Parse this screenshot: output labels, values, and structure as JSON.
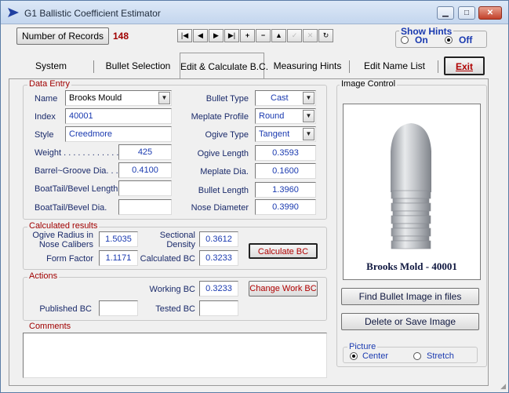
{
  "window": {
    "title": "G1 Ballistic Coefficient Estimator"
  },
  "toolbar": {
    "records_button": "Number of Records",
    "records_count": "148",
    "nav_buttons": [
      "|◀",
      "◀",
      "▶",
      "▶|",
      "+",
      "−",
      "▲",
      "✓",
      "✕",
      "↻"
    ]
  },
  "hints": {
    "label": "Show Hints",
    "on": "On",
    "off": "Off",
    "selected": "Off"
  },
  "tabs": [
    "System",
    "Bullet Selection",
    "Edit & Calculate B.C.",
    "Measuring Hints",
    "Edit Name List"
  ],
  "active_tab": "Edit & Calculate B.C.",
  "exit_button": "Exit",
  "data_entry": {
    "title": "Data Entry",
    "name_label": "Name",
    "name_value": "Brooks Mould",
    "index_label": "Index",
    "index_value": "40001",
    "style_label": "Style",
    "style_value": "Creedmore",
    "weight_label": "Weight . . . . . . . . . . . .",
    "weight_value": "425",
    "barrel_label": "Barrel~Groove Dia. . .",
    "barrel_value": "0.4100",
    "boattail_len_label": "BoatTail/Bevel Length",
    "boattail_len_value": "",
    "boattail_dia_label": "BoatTail/Bevel Dia.",
    "boattail_dia_value": "",
    "bullet_type_label": "Bullet Type",
    "bullet_type_value": "Cast",
    "meplate_profile_label": "Meplate Profile",
    "meplate_profile_value": "Round",
    "ogive_type_label": "Ogive Type",
    "ogive_type_value": "Tangent",
    "ogive_length_label": "Ogive Length",
    "ogive_length_value": "0.3593",
    "meplate_dia_label": "Meplate Dia.",
    "meplate_dia_value": "0.1600",
    "bullet_length_label": "Bullet Length",
    "bullet_length_value": "1.3960",
    "nose_dia_label": "Nose Diameter",
    "nose_dia_value": "0.3990"
  },
  "calculated": {
    "title": "Calculated results",
    "ogive_radius_label_1": "Ogive Radius in",
    "ogive_radius_label_2": "Nose Calibers",
    "ogive_radius_value": "1.5035",
    "sectional_label_1": "Sectional",
    "sectional_label_2": "Density",
    "sectional_value": "0.3612",
    "form_factor_label": "Form Factor",
    "form_factor_value": "1.1171",
    "calc_bc_label": "Calculated BC",
    "calc_bc_value": "0.3233",
    "calculate_button": "Calculate BC"
  },
  "actions": {
    "title": "Actions",
    "working_bc_label": "Working BC",
    "working_bc_value": "0.3233",
    "change_button": "Change Work BC",
    "published_label": "Published BC",
    "published_value": "",
    "tested_label": "Tested BC",
    "tested_value": ""
  },
  "comments": {
    "title": "Comments",
    "value": ""
  },
  "image_control": {
    "title": "Image Control",
    "caption": "Brooks Mold - 40001",
    "find_button": "Find Bullet Image in files",
    "delete_button": "Delete or Save Image",
    "picture_label": "Picture",
    "center": "Center",
    "stretch": "Stretch",
    "selected": "Center"
  }
}
